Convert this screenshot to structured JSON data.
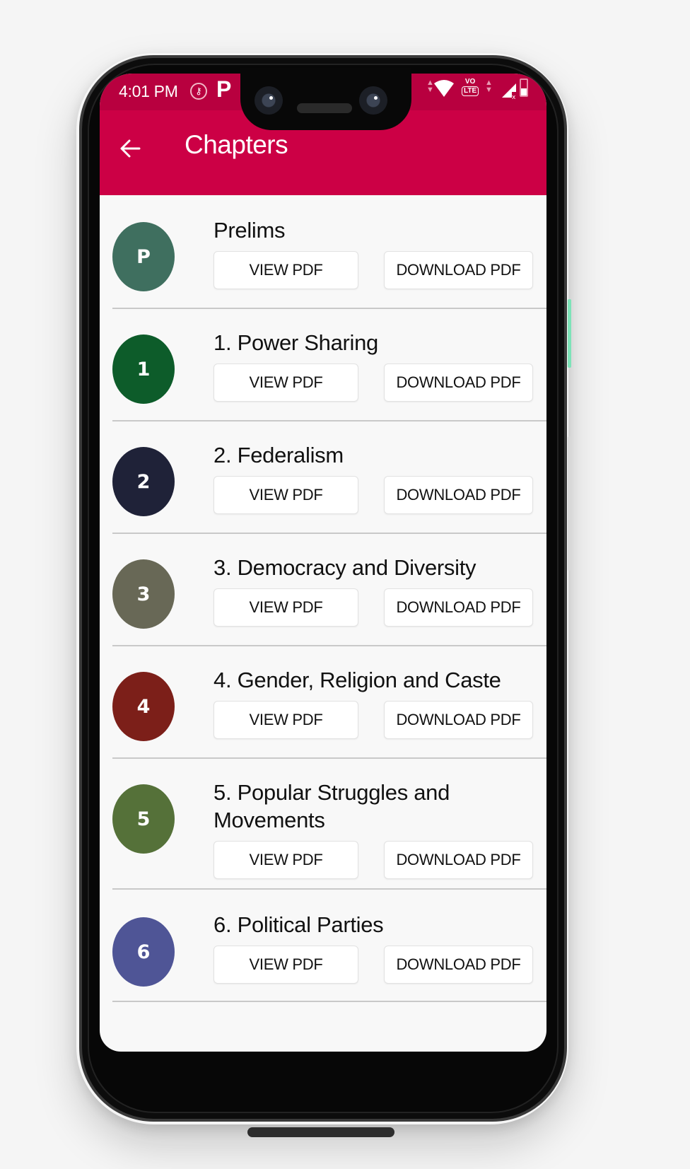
{
  "status_bar": {
    "time": "4:01 PM",
    "icons": [
      "vpn-shield-icon",
      "p-app-icon",
      "data-arrows-icon",
      "wifi-icon",
      "volte-icon",
      "signal-icon",
      "battery-charging-icon"
    ],
    "volte_top": "VO",
    "volte_bottom": "LTE",
    "vpn_glyph": "⚷",
    "p_glyph": "P"
  },
  "app_bar": {
    "title": "Chapters",
    "back_glyph": "←"
  },
  "colors": {
    "primary": "#cc0045",
    "status_bar": "#b8003f"
  },
  "chapters": [
    {
      "avatar": "P",
      "title": "Prelims",
      "avatar_color": "#3f6f5f",
      "view_label": "VIEW PDF",
      "download_label": "DOWNLOAD PDF"
    },
    {
      "avatar": "1",
      "title": "1. Power Sharing",
      "avatar_color": "#0d5c2a",
      "view_label": "VIEW PDF",
      "download_label": "DOWNLOAD PDF"
    },
    {
      "avatar": "2",
      "title": "2. Federalism",
      "avatar_color": "#1f2238",
      "view_label": "VIEW PDF",
      "download_label": "DOWNLOAD PDF"
    },
    {
      "avatar": "3",
      "title": "3. Democracy and Diversity",
      "avatar_color": "#686856",
      "view_label": "VIEW PDF",
      "download_label": "DOWNLOAD PDF"
    },
    {
      "avatar": "4",
      "title": "4. Gender, Religion and Caste",
      "avatar_color": "#7c1f19",
      "view_label": "VIEW PDF",
      "download_label": "DOWNLOAD PDF"
    },
    {
      "avatar": "5",
      "title": "5. Popular Struggles and Movements",
      "avatar_color": "#557139",
      "view_label": "VIEW PDF",
      "download_label": "DOWNLOAD PDF"
    },
    {
      "avatar": "6",
      "title": "6. Political Parties",
      "avatar_color": "#4f5596",
      "view_label": "VIEW PDF",
      "download_label": "DOWNLOAD PDF"
    }
  ]
}
